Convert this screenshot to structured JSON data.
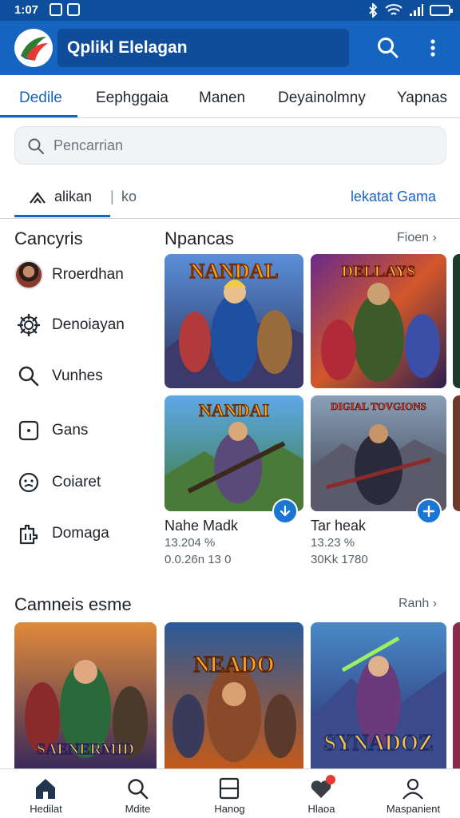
{
  "status_bar": {
    "time": "1:07",
    "icons": [
      "image-icon",
      "message-icon",
      "bluetooth-icon",
      "wifi-icon",
      "signal-icon",
      "battery-icon"
    ]
  },
  "app_bar": {
    "title": "Qplikl Elelagan",
    "icons": [
      "app-logo",
      "search-icon",
      "more-vert-icon"
    ]
  },
  "tabs": [
    {
      "label": "Dedile",
      "active": true
    },
    {
      "label": "Eephggaia"
    },
    {
      "label": "Manen"
    },
    {
      "label": "Deyainolmny"
    },
    {
      "label": "Yapnas"
    }
  ],
  "search": {
    "placeholder": "Pencarrian"
  },
  "filters": {
    "primary": "alikan",
    "secondary": "ko",
    "link": "lekatat Gama"
  },
  "sidebar": {
    "title": "Cancyris",
    "items": [
      {
        "label": "Rroerdhan",
        "icon": "avatar"
      },
      {
        "label": "Denoiayan",
        "icon": "gear-icon"
      },
      {
        "label": "Vunhes",
        "icon": "search-icon"
      },
      {
        "label": "Gans",
        "icon": "square-icon"
      },
      {
        "label": "Coiaret",
        "icon": "face-icon"
      },
      {
        "label": "Domaga",
        "icon": "puzzle-icon"
      }
    ]
  },
  "popular": {
    "title": "Npancas",
    "more": "Fioen",
    "cards": [
      {
        "title_art": "NANDAL"
      },
      {
        "title_art": "DELLAYS"
      },
      {
        "title_art": "NANDAI",
        "name": "Nahe Madk",
        "rating": "13.204 %",
        "downloads": "0.0.26n 13 0"
      },
      {
        "title_art": "DIGIAL TOVGIONS",
        "name": "Tar heak",
        "rating": "13.23 %",
        "downloads": "30Kk 1780"
      }
    ]
  },
  "gamesections": {
    "title": "Camneis esme",
    "more": "Ranh",
    "cards": [
      {
        "title_art": "SAENERMID"
      },
      {
        "title_art": "NEADO"
      },
      {
        "title_art": "SYNADOZ"
      }
    ]
  },
  "bottom_nav": [
    {
      "label": "Hedilat",
      "icon": "home-icon",
      "active": true
    },
    {
      "label": "Mdite",
      "icon": "search-icon"
    },
    {
      "label": "Hanog",
      "icon": "window-icon"
    },
    {
      "label": "Hlaoa",
      "icon": "heart-icon",
      "badge": true
    },
    {
      "label": "Maspanient",
      "icon": "profile-icon"
    }
  ],
  "colors": {
    "primary": "#1565c0",
    "status_bar": "#0d4f9c",
    "accent_badge": "#e53935"
  }
}
